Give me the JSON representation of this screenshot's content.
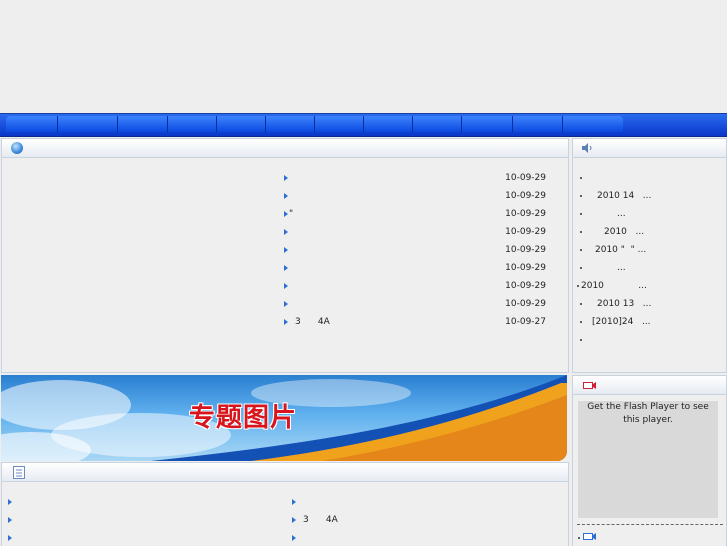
{
  "nav": {
    "items": [
      "",
      "",
      "",
      "",
      "",
      "",
      "",
      "",
      "",
      "",
      "",
      ""
    ]
  },
  "news": {
    "rows": [
      {
        "title": "",
        "date": "10-09-29"
      },
      {
        "title": "",
        "date": "10-09-29"
      },
      {
        "title": "\"",
        "date": "10-09-29"
      },
      {
        "title": "",
        "date": "10-09-29"
      },
      {
        "title": "",
        "date": "10-09-29"
      },
      {
        "title": "",
        "date": "10-09-29"
      },
      {
        "title": "",
        "date": "10-09-29"
      },
      {
        "title": "",
        "date": "10-09-29"
      },
      {
        "title": "3      4A",
        "date": "10-09-27"
      }
    ]
  },
  "notices": {
    "items": [
      "",
      "2010 14   ...",
      "...",
      "2010   ...",
      "2010 \"  \" ...",
      "...",
      "2010            ...",
      "2010 13   ...",
      "[2010]24   ...",
      ""
    ]
  },
  "banner": {
    "title": "专题图片"
  },
  "video": {
    "flash_text": "Get the Flash Player to see this player."
  },
  "bottom": {
    "left_rows": [
      "",
      "",
      ""
    ],
    "right_rows": [
      "",
      "3      4A",
      ""
    ]
  },
  "colors": {
    "nav": "#0a3ad0",
    "accent": "#2d6fd4",
    "banner_title": "#d8141c"
  }
}
